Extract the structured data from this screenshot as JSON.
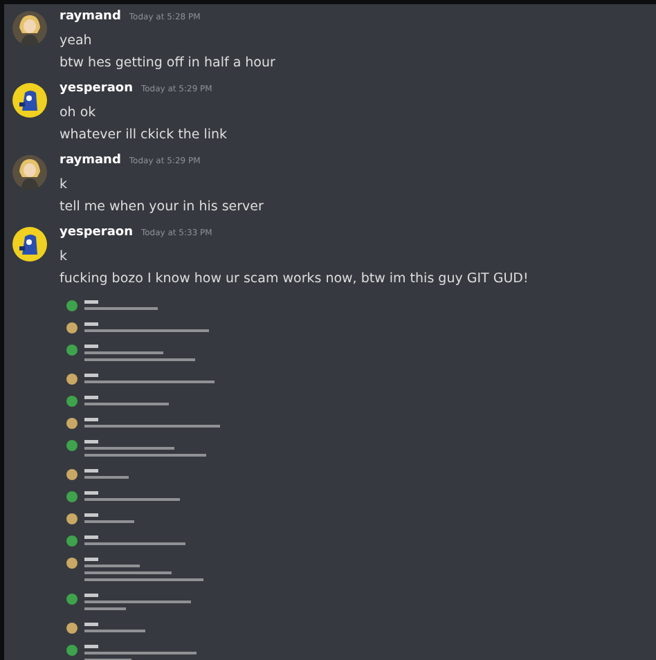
{
  "messages": [
    {
      "author": "raymand",
      "kind": "figure",
      "time": "Today at 5:28 PM",
      "lines": [
        "yeah",
        "btw hes getting off in half a hour"
      ]
    },
    {
      "author": "yesperaon",
      "kind": "mascot",
      "time": "Today at 5:29 PM",
      "lines": [
        "oh ok",
        "whatever ill ckick the link"
      ]
    },
    {
      "author": "raymand",
      "kind": "figure",
      "time": "Today at 5:29 PM",
      "lines": [
        "k",
        "tell me when your in his server"
      ]
    },
    {
      "author": "yesperaon",
      "kind": "mascot",
      "time": "Today at 5:33 PM",
      "lines": [
        "k",
        "fucking bozo I know how ur scam works now, btw im this guy GIT GUD!"
      ]
    }
  ]
}
